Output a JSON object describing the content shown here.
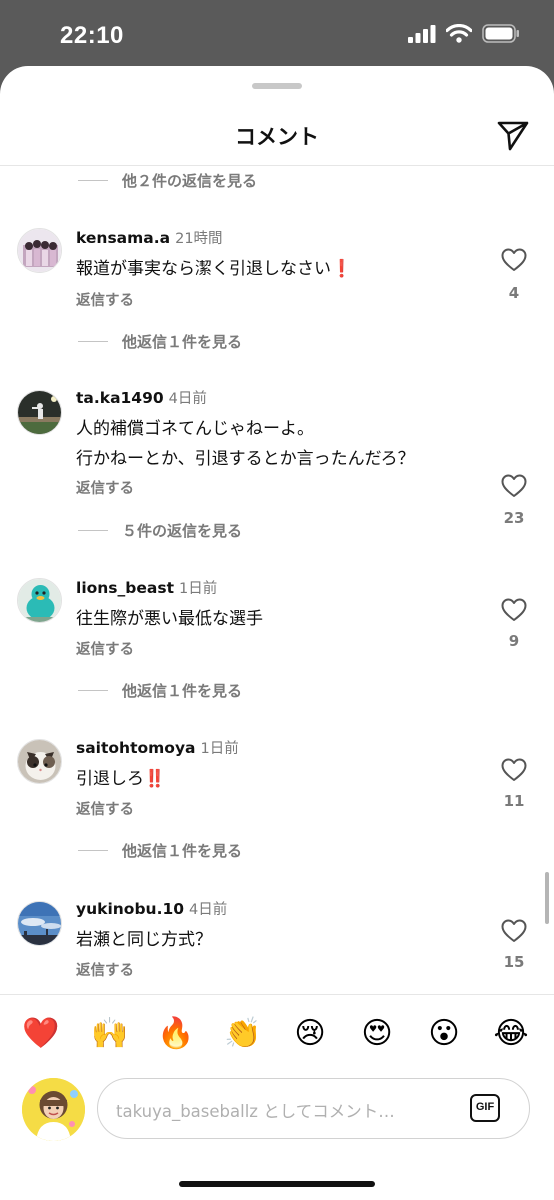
{
  "status_bar": {
    "time": "22:10"
  },
  "header": {
    "title": "コメント"
  },
  "top_replies": "他２件の返信を見る",
  "comments": [
    {
      "username": "kensama.a",
      "time": "21時間",
      "lines": [
        "報道が事実なら潔く引退しなさい❗"
      ],
      "reply_label": "返信する",
      "likes": "4",
      "replies_label": "他返信１件を見る"
    },
    {
      "username": "ta.ka1490",
      "time": "4日前",
      "lines": [
        "人的補償ゴネてんじゃねーよ。",
        "行かねーとか、引退するとか言ったんだろ？"
      ],
      "reply_label": "返信する",
      "likes": "23",
      "replies_label": "５件の返信を見る"
    },
    {
      "username": "lions_beast",
      "time": "1日前",
      "lines": [
        "往生際が悪い最低な選手"
      ],
      "reply_label": "返信する",
      "likes": "9",
      "replies_label": "他返信１件を見る"
    },
    {
      "username": "saitohtomoya",
      "time": "1日前",
      "lines": [
        "引退しろ‼️"
      ],
      "reply_label": "返信する",
      "likes": "11",
      "replies_label": "他返信１件を見る"
    },
    {
      "username": "yukinobu.10",
      "time": "4日前",
      "lines": [
        "岩瀬と同じ方式？"
      ],
      "reply_label": "返信する",
      "likes": "15"
    }
  ],
  "reactions": [
    "❤️",
    "🙌",
    "🔥",
    "👏",
    "😢",
    "😍",
    "😮",
    "😂"
  ],
  "composer": {
    "placeholder": "takuya_baseballz としてコメント…",
    "gif_label": "GIF"
  }
}
